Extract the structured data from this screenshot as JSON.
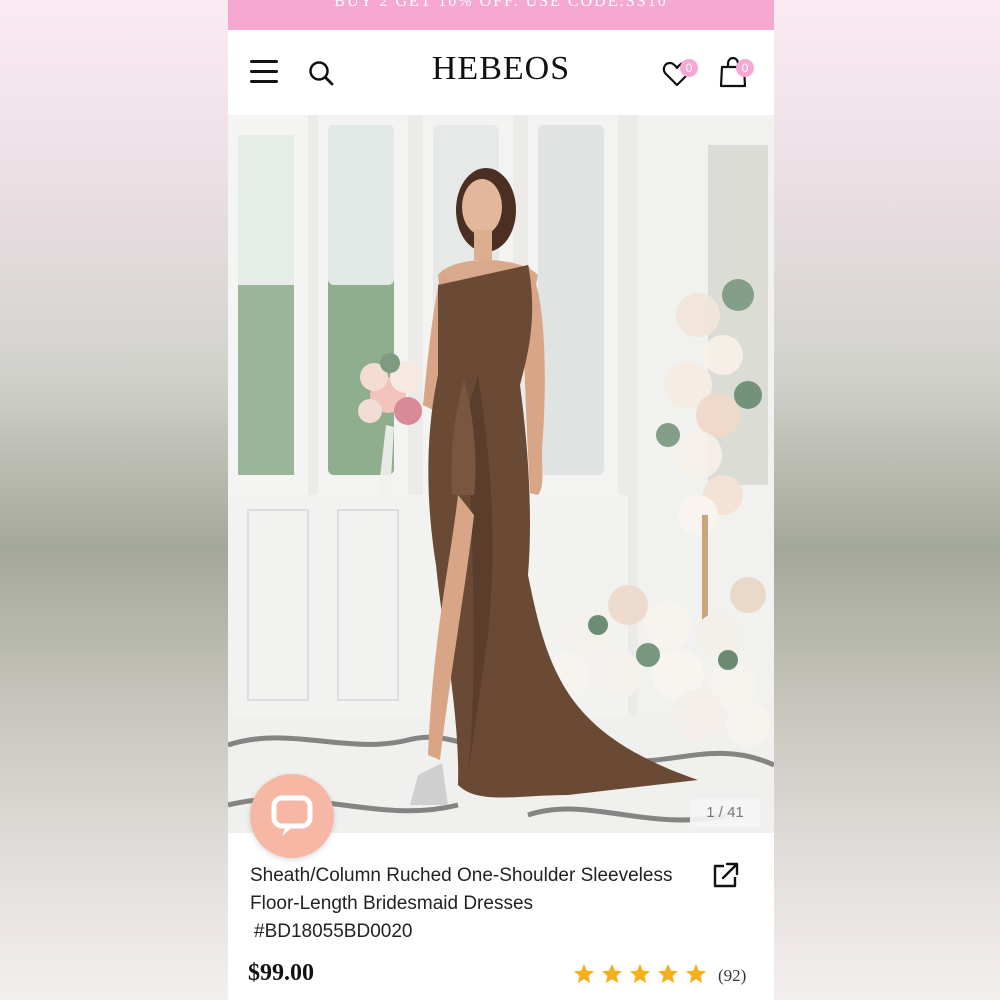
{
  "promo": {
    "text": "BUY 2 GET 10% OFF. USE CODE:SS10"
  },
  "header": {
    "logo": "HEBEOS",
    "wishlist_count": "0",
    "cart_count": "0"
  },
  "gallery": {
    "counter": "1 / 41"
  },
  "product": {
    "title_line1": "Sheath/Column Ruched One-Shoulder Sleeveless",
    "title_line2": "Floor-Length Bridesmaid Dresses",
    "sku": "#BD18055BD0020",
    "price": "$99.00",
    "rating": 5,
    "review_count": "(92)"
  },
  "colors": {
    "promo_bar": "#f7a8d2",
    "badge": "#f7a8d2",
    "chat_button": "#f6b7a5",
    "star": "#f2b01e",
    "dress": "#6b4a35"
  },
  "icons": {
    "menu": "hamburger-icon",
    "search": "search-icon",
    "wishlist": "heart-icon",
    "cart": "bag-icon",
    "chat": "chat-bubble-icon",
    "share": "share-icon"
  }
}
